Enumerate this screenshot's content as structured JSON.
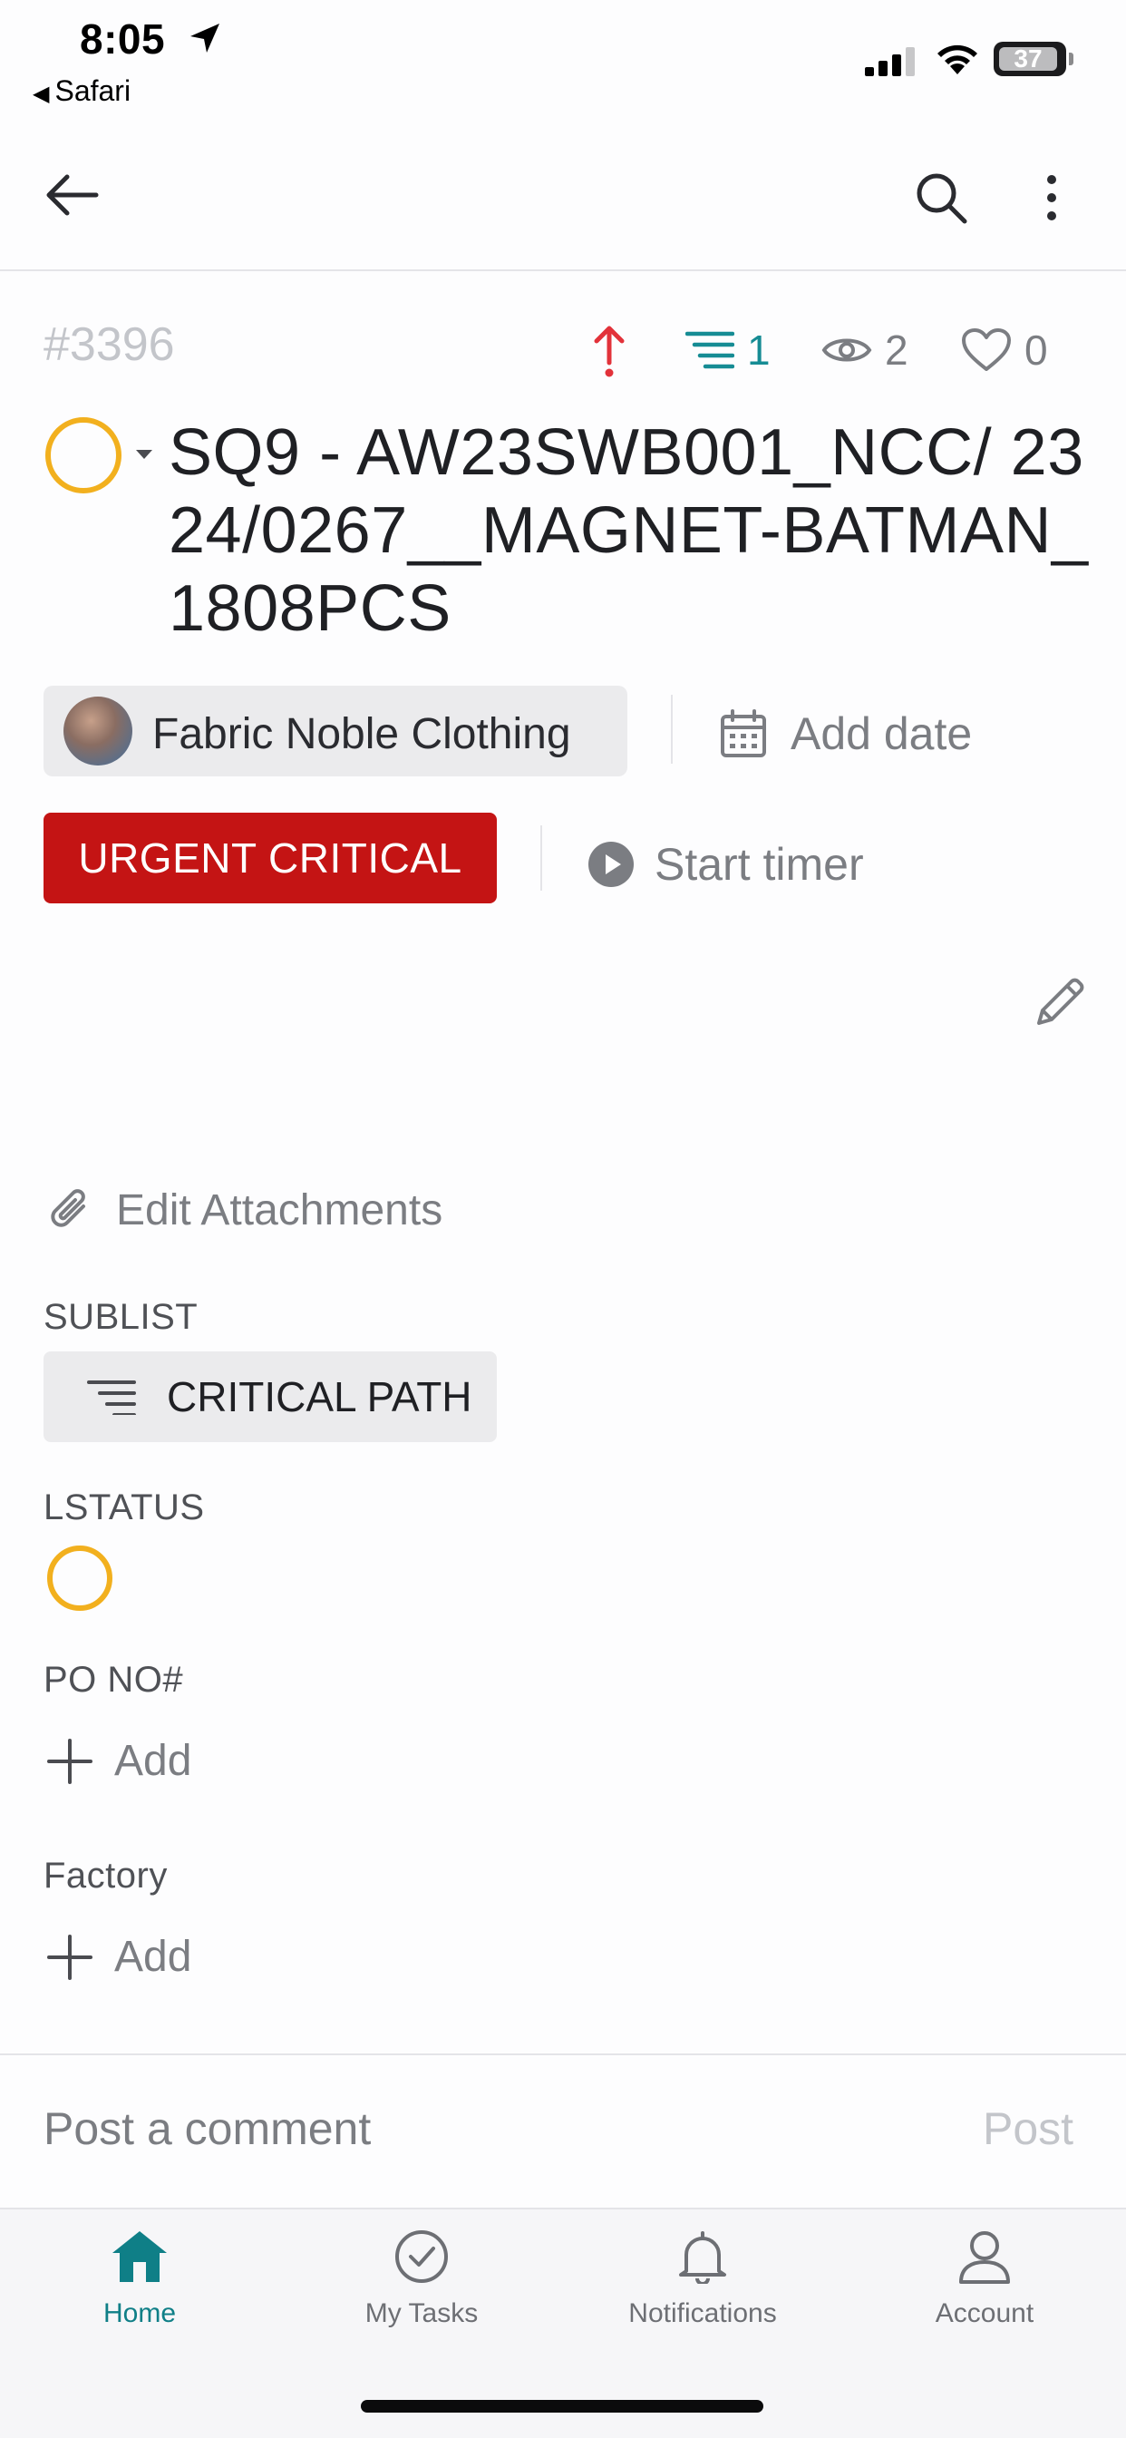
{
  "status_bar": {
    "time": "8:05",
    "back_app": "Safari",
    "battery": "37"
  },
  "task": {
    "id": "#3396",
    "title": "SQ9 - AW23SWB001_NCC/ 2324/0267__MAGNET-BATMAN_1808PCS",
    "status_color": "#f2b01e",
    "priority_icon": "arrow-up-icon",
    "sublist_count": "1",
    "watchers": "2",
    "likes": "0"
  },
  "assignee": {
    "name": "Fabric Noble Clothing"
  },
  "date": {
    "label": "Add date"
  },
  "priority": {
    "label": "URGENT CRITICAL",
    "color": "#c41414"
  },
  "timer": {
    "label": "Start timer"
  },
  "attachments": {
    "label": "Edit Attachments"
  },
  "fields": {
    "sublist_label": "SUBLIST",
    "sublist_value": "CRITICAL PATH",
    "lstatus_label": "LSTATUS",
    "po_label": "PO NO#",
    "po_add": "Add",
    "factory_label": "Factory",
    "factory_add": "Add"
  },
  "comment": {
    "placeholder": "Post a comment",
    "post_label": "Post"
  },
  "tabs": [
    {
      "label": "Home",
      "icon": "home-icon",
      "active": true
    },
    {
      "label": "My Tasks",
      "icon": "check-circle-icon",
      "active": false
    },
    {
      "label": "Notifications",
      "icon": "bell-icon",
      "active": false
    },
    {
      "label": "Account",
      "icon": "person-icon",
      "active": false
    }
  ],
  "colors": {
    "accent": "#0f7f87",
    "sublist_accent": "#168c94",
    "priority_arrow": "#e2323a"
  }
}
